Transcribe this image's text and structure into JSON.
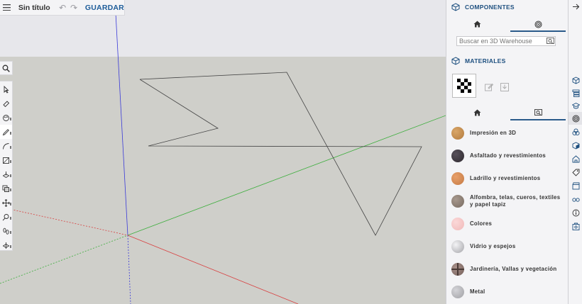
{
  "topbar": {
    "title": "Sin título",
    "save_label": "GUARDAR"
  },
  "components": {
    "header": "COMPONENTES",
    "search_placeholder": "Buscar en 3D Warehouse"
  },
  "materials": {
    "header": "MATERIALES",
    "items": [
      {
        "name": "Impresión en 3D",
        "color": "#c28a4a"
      },
      {
        "name": "Asfaltado y revestimientos",
        "color": "#3c373c"
      },
      {
        "name": "Ladrillo y revestimientos",
        "color": "#cf8752"
      },
      {
        "name": "Alfombra, telas, cueros, textiles y papel tapiz",
        "color": "#8a7c72"
      },
      {
        "name": "Colores",
        "color": "#f4c4c4"
      },
      {
        "name": "Vidrio y espejos",
        "color": "#d0d0d4"
      },
      {
        "name": "Jardinería, Vallas y vegetación",
        "color": "#8a6f6a"
      },
      {
        "name": "Metal",
        "color": "#b5b5b8"
      }
    ]
  },
  "colors": {
    "accent": "#1d4f7f",
    "sky": "#e6e6ea",
    "ground": "#cfcfca"
  }
}
